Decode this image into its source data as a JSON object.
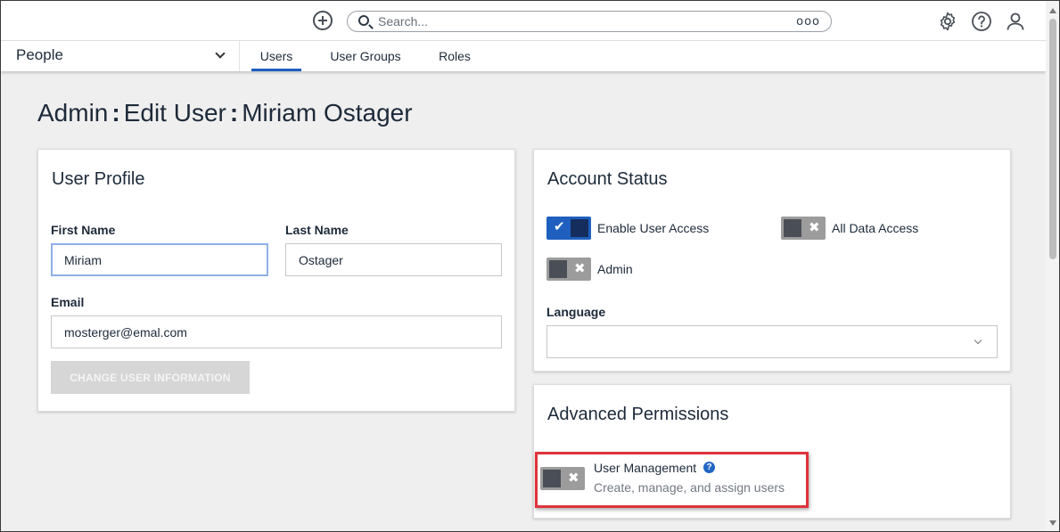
{
  "header": {
    "search_placeholder": "Search...",
    "search_options_glyph": "ooo",
    "icons": [
      "add-circle-icon",
      "search-icon",
      "more-options-icon",
      "gear-icon",
      "help-icon",
      "user-icon"
    ]
  },
  "nav": {
    "module": "People",
    "tabs": [
      {
        "label": "Users",
        "active": true
      },
      {
        "label": "User Groups",
        "active": false
      },
      {
        "label": "Roles",
        "active": false
      }
    ]
  },
  "page": {
    "title_part1": "Admin",
    "title_part2": "Edit User",
    "title_part3": "Miriam Ostager",
    "separator": ":"
  },
  "user_profile": {
    "title": "User Profile",
    "first_name_label": "First Name",
    "first_name_value": "Miriam",
    "last_name_label": "Last Name",
    "last_name_value": "Ostager",
    "email_label": "Email",
    "email_value": "mosterger@emal.com",
    "change_button": "CHANGE USER INFORMATION"
  },
  "account_status": {
    "title": "Account Status",
    "toggles": [
      {
        "label": "Enable User Access",
        "on": true
      },
      {
        "label": "All Data Access",
        "on": false
      },
      {
        "label": "Admin",
        "on": false
      }
    ],
    "language_label": "Language",
    "language_value": ""
  },
  "advanced_permissions": {
    "title": "Advanced Permissions",
    "permission_title": "User Management",
    "permission_help": "?",
    "permission_desc": "Create, manage, and assign users",
    "permission_on": false
  },
  "colors": {
    "accent": "#1f5fbf",
    "highlight": "#e0333b",
    "toggle_off": "#9c9c9c"
  }
}
